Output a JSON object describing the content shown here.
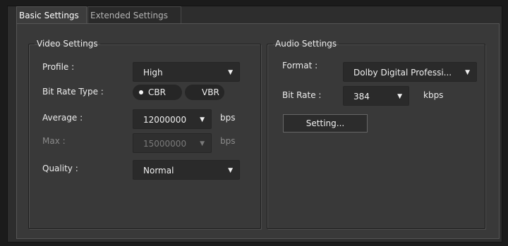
{
  "tabs": [
    {
      "label": "Basic Settings",
      "active": true
    },
    {
      "label": "Extended Settings",
      "active": false
    }
  ],
  "video": {
    "group_title": "Video Settings",
    "profile_label": "Profile :",
    "profile_value": "High",
    "bitrate_type_label": "Bit Rate Type :",
    "cbr_label": "CBR",
    "vbr_label": "VBR",
    "selected_bitrate_type": "CBR",
    "average_label": "Average :",
    "average_value": "12000000",
    "average_unit": "bps",
    "max_label": "Max :",
    "max_value": "15000000",
    "max_unit": "bps",
    "quality_label": "Quality :",
    "quality_value": "Normal"
  },
  "audio": {
    "group_title": "Audio Settings",
    "format_label": "Format :",
    "format_value": "Dolby Digital Professi...",
    "bitrate_label": "Bit Rate :",
    "bitrate_value": "384",
    "bitrate_unit": "kbps",
    "setting_button": "Setting..."
  },
  "colors": {
    "window_bg": "#2d2d2d",
    "panel_bg": "#393939",
    "control_bg": "#2a2a2a",
    "text": "#ececec",
    "disabled_text": "#8a8a8a"
  },
  "icons": {
    "dropdown": "caret-down-icon",
    "radio_selected": "radio-dot-icon"
  }
}
